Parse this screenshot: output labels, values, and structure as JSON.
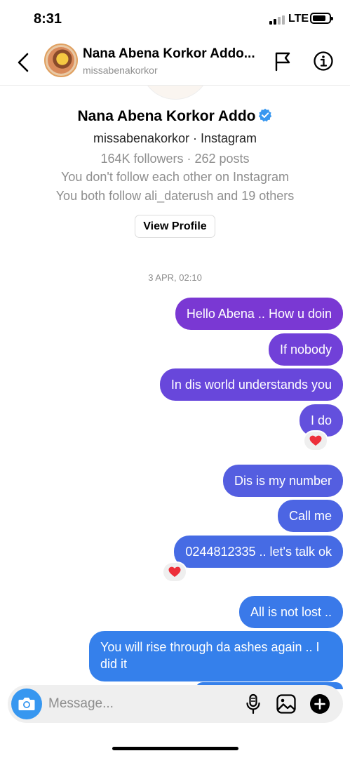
{
  "status_bar": {
    "time": "8:31",
    "network": "LTE",
    "battery_level": 0.65
  },
  "header": {
    "name": "Nana Abena Korkor Addo...",
    "handle": "missabenakorkor"
  },
  "profile": {
    "name": "Nana Abena Korkor Addo",
    "subtitle": "missabenakorkor · Instagram",
    "stats": "164K followers · 262 posts",
    "follow_status": "You don't follow each other on Instagram",
    "mutuals": "You both follow ali_daterush and 19 others",
    "view_profile_label": "View Profile"
  },
  "timestamp": "3 APR, 02:10",
  "messages": [
    {
      "text": "Hello Abena .. How u doin",
      "color": "#7a38d3"
    },
    {
      "text": "If nobody",
      "color": "#7140d8"
    },
    {
      "text": "In dis world understands you",
      "color": "#6847db"
    },
    {
      "text": "I do",
      "color": "#6350dd",
      "reaction": "❤️"
    },
    {
      "text": "Dis is my number",
      "color": "#545ee0"
    },
    {
      "text": "Call me",
      "color": "#4c65e3"
    },
    {
      "text": "0244812335 .. let's talk ok",
      "color": "#466be4",
      "reaction": "❤️"
    },
    {
      "text": "All is not lost ..",
      "color": "#3a79e9"
    },
    {
      "text": "You will rise through da ashes again .. I did it",
      "color": "#3580eb"
    }
  ],
  "composer": {
    "placeholder": "Message..."
  },
  "colors": {
    "accent": "#3797f0",
    "verified": "#3897f0",
    "heart": "#ed2f3a"
  }
}
